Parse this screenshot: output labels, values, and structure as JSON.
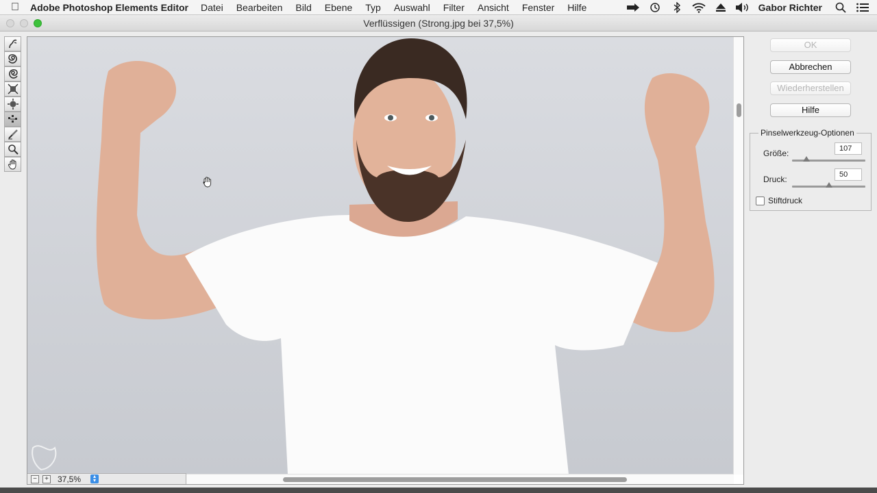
{
  "menubar": {
    "app_name": "Adobe Photoshop Elements Editor",
    "items": [
      "Datei",
      "Bearbeiten",
      "Bild",
      "Ebene",
      "Typ",
      "Auswahl",
      "Filter",
      "Ansicht",
      "Fenster",
      "Hilfe"
    ],
    "user_name": "Gabor Richter",
    "status_icons": [
      "arrow-icon",
      "time-machine-icon",
      "bluetooth-icon",
      "wifi-icon",
      "eject-icon",
      "volume-icon"
    ]
  },
  "window": {
    "title": "Verflüssigen (Strong.jpg bei 37,5%)"
  },
  "tools": [
    {
      "name": "forward-warp-tool-icon",
      "active": false
    },
    {
      "name": "twirl-clockwise-tool-icon",
      "active": false
    },
    {
      "name": "twirl-counterclockwise-tool-icon",
      "active": false
    },
    {
      "name": "pucker-tool-icon",
      "active": false
    },
    {
      "name": "bloat-tool-icon",
      "active": false
    },
    {
      "name": "shift-pixels-tool-icon",
      "active": true
    },
    {
      "name": "reconstruct-tool-icon",
      "active": false
    },
    {
      "name": "zoom-tool-icon",
      "active": false
    },
    {
      "name": "hand-tool-icon",
      "active": false
    }
  ],
  "zoom": {
    "value": "37,5%"
  },
  "buttons": {
    "ok": "OK",
    "cancel": "Abbrechen",
    "restore": "Wiederherstellen",
    "help": "Hilfe"
  },
  "brush_options": {
    "title": "Pinselwerkzeug-Optionen",
    "size_label": "Größe:",
    "size_value": "107",
    "size_fraction": 0.2,
    "pressure_label": "Druck:",
    "pressure_value": "50",
    "pressure_fraction": 0.5,
    "stylus_label": "Stiftdruck",
    "stylus_checked": false
  },
  "colors": {
    "background": "#d6d8dd",
    "shirt": "#fbfbfb",
    "skin": "#e2b39a",
    "hair": "#3a2a22"
  }
}
